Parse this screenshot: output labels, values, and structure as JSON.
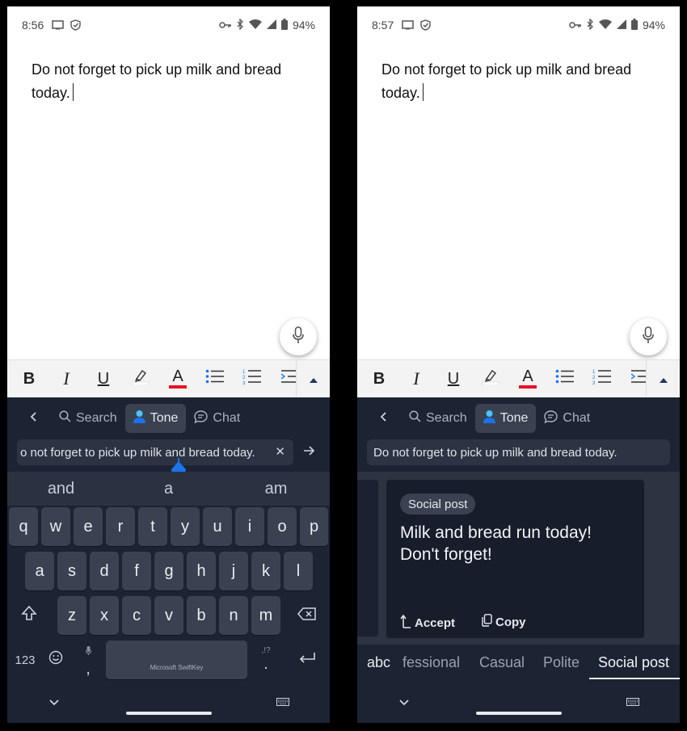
{
  "left": {
    "status": {
      "time": "8:56",
      "battery": "94%"
    },
    "document": {
      "text": "Do not forget to pick up milk and bread today."
    },
    "toolbar": {
      "bold": "B",
      "italic": "I",
      "underline": "U",
      "font_color": "A",
      "highlight_color": "#ffffff",
      "text_color": "#e81123"
    },
    "keyboard": {
      "nav": {
        "search": "Search",
        "tone": "Tone",
        "chat": "Chat"
      },
      "input_value": "o not forget to pick up milk and bread today.",
      "suggestions": [
        "and",
        "a",
        "am"
      ],
      "row1": [
        "q",
        "w",
        "e",
        "r",
        "t",
        "y",
        "u",
        "i",
        "o",
        "p"
      ],
      "row2": [
        "a",
        "s",
        "d",
        "f",
        "g",
        "h",
        "j",
        "k",
        "l"
      ],
      "row3": [
        "z",
        "x",
        "c",
        "v",
        "b",
        "n",
        "m"
      ],
      "numbers_key": "123",
      "space_label": "Microsoft SwiftKey",
      "comma": ",",
      "period": ".",
      "punct_hint": ",!?"
    }
  },
  "right": {
    "status": {
      "time": "8:57",
      "battery": "94%"
    },
    "document": {
      "text": "Do not forget to pick up milk and bread today."
    },
    "toolbar": {
      "bold": "B",
      "italic": "I",
      "underline": "U",
      "font_color": "A"
    },
    "keyboard": {
      "nav": {
        "search": "Search",
        "tone": "Tone",
        "chat": "Chat"
      },
      "input_value": "Do not forget to pick up milk and bread today.",
      "card": {
        "chip": "Social post",
        "text": "Milk and bread run today! Don't forget!",
        "accept": "Accept",
        "copy": "Copy"
      },
      "tabs": {
        "abc": "abc",
        "professional": "fessional",
        "casual": "Casual",
        "polite": "Polite",
        "social": "Social post"
      }
    }
  },
  "colors": {
    "keyboard_bg": "#1c2333",
    "accent_blue": "#1a73e8",
    "red": "#e81123"
  }
}
